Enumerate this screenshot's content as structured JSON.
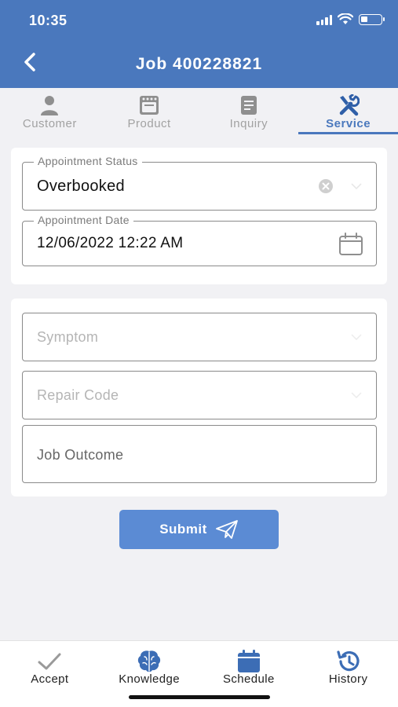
{
  "status_bar": {
    "time": "10:35"
  },
  "header": {
    "title": "Job  400228821",
    "back_icon": "chevron-left-icon"
  },
  "tabs": [
    {
      "label": "Customer",
      "icon": "person-icon",
      "active": false
    },
    {
      "label": "Product",
      "icon": "oven-icon",
      "active": false
    },
    {
      "label": "Inquiry",
      "icon": "document-icon",
      "active": false
    },
    {
      "label": "Service",
      "icon": "tools-icon",
      "active": true
    }
  ],
  "appointment": {
    "status_label": "Appointment Status",
    "status_value": "Overbooked",
    "date_label": "Appointment Date",
    "date_value": "12/06/2022 12:22 AM"
  },
  "service_form": {
    "symptom_placeholder": "Symptom",
    "repair_code_placeholder": "Repair Code",
    "job_outcome_placeholder": "Job Outcome"
  },
  "submit": {
    "label": "Submit",
    "icon": "paper-plane-icon"
  },
  "bottom_nav": [
    {
      "label": "Accept",
      "icon": "checkmark-icon"
    },
    {
      "label": "Knowledge",
      "icon": "brain-icon"
    },
    {
      "label": "Schedule",
      "icon": "calendar-icon"
    },
    {
      "label": "History",
      "icon": "history-icon"
    }
  ],
  "colors": {
    "primary": "#4a78bd",
    "button": "#5b8bd4",
    "inactive": "#a2a2a2"
  }
}
